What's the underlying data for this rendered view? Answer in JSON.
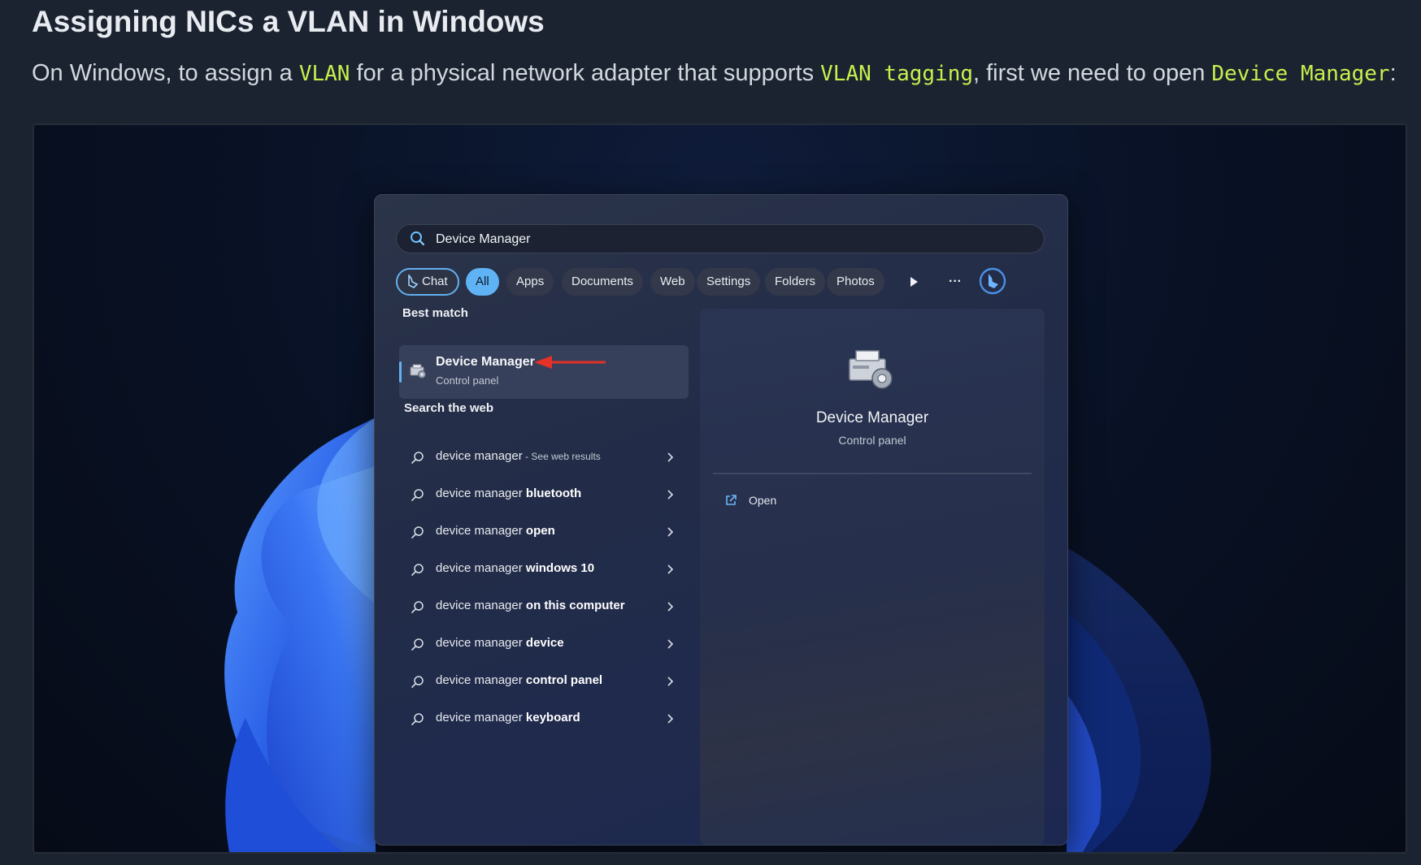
{
  "article": {
    "title": "Assigning NICs a VLAN in Windows",
    "intro": {
      "part1": "On Windows, to assign a ",
      "code1": "VLAN",
      "part2": " for a physical network adapter that supports ",
      "code2": "VLAN tagging",
      "part3": ", first we need to open ",
      "code3": "Device Manager",
      "part4": ":"
    }
  },
  "search": {
    "query": "Device Manager",
    "chips": [
      {
        "label": "Chat"
      },
      {
        "label": "All"
      },
      {
        "label": "Apps"
      },
      {
        "label": "Documents"
      },
      {
        "label": "Web"
      },
      {
        "label": "Settings"
      },
      {
        "label": "Folders"
      },
      {
        "label": "Photos"
      }
    ],
    "more_label": "···",
    "best_match_label": "Best match",
    "best_match": {
      "name": "Device Manager",
      "sub": "Control panel"
    },
    "web_label": "Search the web",
    "web_results": [
      {
        "prefix": "device manager",
        "bold": "",
        "suffix": " - See web results"
      },
      {
        "prefix": "device manager ",
        "bold": "bluetooth",
        "suffix": ""
      },
      {
        "prefix": "device manager ",
        "bold": "open",
        "suffix": ""
      },
      {
        "prefix": "device manager ",
        "bold": "windows 10",
        "suffix": ""
      },
      {
        "prefix": "device manager ",
        "bold": "on this computer",
        "suffix": ""
      },
      {
        "prefix": "device manager ",
        "bold": "device",
        "suffix": ""
      },
      {
        "prefix": "device manager ",
        "bold": "control panel",
        "suffix": ""
      },
      {
        "prefix": "device manager ",
        "bold": "keyboard",
        "suffix": ""
      }
    ],
    "detail": {
      "name": "Device Manager",
      "sub": "Control panel",
      "open_label": "Open"
    }
  },
  "colors": {
    "accent": "#63b0f2",
    "code": "#c6f04e",
    "arrow": "#e53127"
  },
  "icons": [
    "search-icon",
    "bing-icon",
    "play-icon",
    "device-manager-icon",
    "red-arrow-annotation",
    "chevron-right-icon",
    "open-external-icon"
  ]
}
